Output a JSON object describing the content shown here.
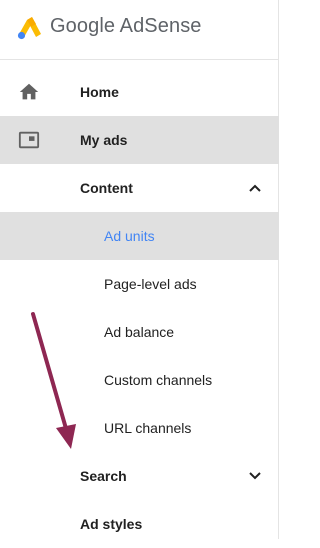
{
  "brand": {
    "name": "Google AdSense"
  },
  "nav": {
    "home": "Home",
    "my_ads": "My ads",
    "content": "Content",
    "ad_units": "Ad units",
    "page_level_ads": "Page-level ads",
    "ad_balance": "Ad balance",
    "custom_channels": "Custom channels",
    "url_channels": "URL channels",
    "search": "Search",
    "ad_styles": "Ad styles"
  },
  "icons": {
    "home": "home-icon",
    "my_ads": "ads-display-icon",
    "content_chevron": "chevron-up-icon",
    "search_chevron": "chevron-down-icon"
  },
  "colors": {
    "active_bg": "#e0e0e0",
    "link_blue": "#4285f4",
    "annotation_arrow": "#8e2752"
  }
}
